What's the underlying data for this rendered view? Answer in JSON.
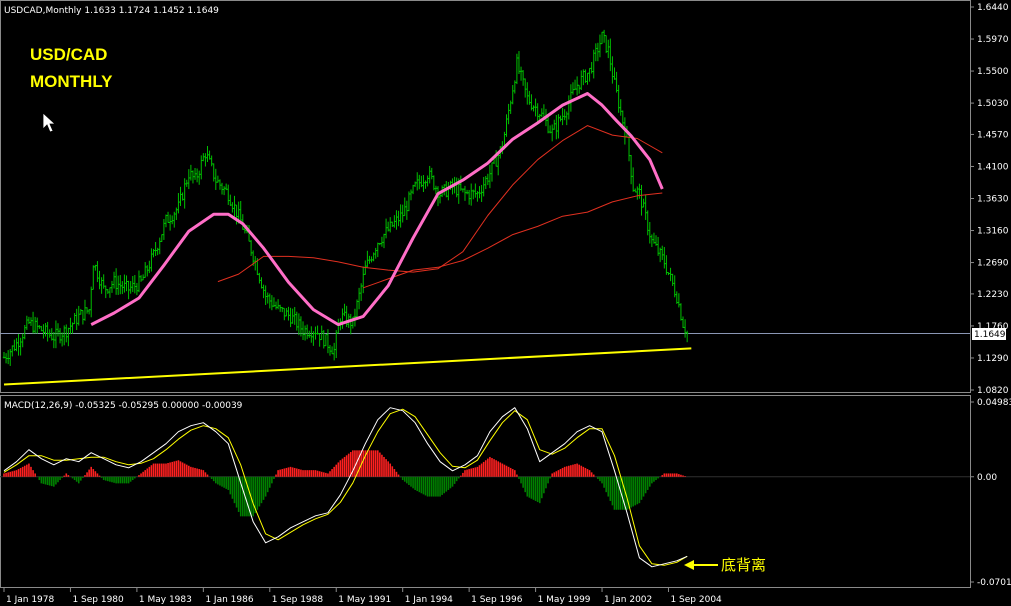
{
  "main_header": "USDCAD,Monthly  1.1633 1.1724 1.1452 1.1649",
  "title_line1": "USD/CAD",
  "title_line2": "MONTHLY",
  "macd_header": "MACD(12,26,9) -0.05325 -0.05295 0.00000 -0.00039",
  "annotation": "底背离",
  "current_price_label": "1.1649",
  "colors": {
    "background": "#000000",
    "bars": "#00c000",
    "ma_pink": "#ff6ec7",
    "ma_red": "#e03020",
    "trendline": "#ffff00",
    "hist_up": "#ff2020",
    "hist_down": "#008000",
    "macd_line": "#ffffff",
    "signal_line": "#ffff00"
  },
  "chart_data": [
    {
      "type": "ohlc",
      "title": "USDCAD,Monthly",
      "ohlc_last": {
        "open": 1.1633,
        "high": 1.1724,
        "low": 1.1452,
        "close": 1.1649
      },
      "x_tick_labels": [
        "1 Jan 1978",
        "1 Sep 1980",
        "1 May 1983",
        "1 Jan 1986",
        "1 Sep 1988",
        "1 May 1991",
        "1 Jan 1994",
        "1 Sep 1996",
        "1 May 1999",
        "1 Jan 2002",
        "1 Sep 2004"
      ],
      "y_tick_labels": [
        "1.6440",
        "1.5970",
        "1.5500",
        "1.5030",
        "1.4570",
        "1.4100",
        "1.3630",
        "1.3160",
        "1.2690",
        "1.2230",
        "1.1760",
        "1.1290",
        "1.0820"
      ],
      "ylim": [
        1.082,
        1.644
      ],
      "current_price": 1.1649,
      "close_path": [
        [
          "1978-01",
          1.13
        ],
        [
          "1978-07",
          1.15
        ],
        [
          "1979-01",
          1.18
        ],
        [
          "1979-07",
          1.17
        ],
        [
          "1980-01",
          1.16
        ],
        [
          "1980-07",
          1.17
        ],
        [
          "1981-01",
          1.19
        ],
        [
          "1981-06",
          1.2
        ],
        [
          "1981-08",
          1.27
        ],
        [
          "1982-01",
          1.23
        ],
        [
          "1982-06",
          1.24
        ],
        [
          "1983-01",
          1.23
        ],
        [
          "1983-07",
          1.24
        ],
        [
          "1984-01",
          1.28
        ],
        [
          "1984-07",
          1.33
        ],
        [
          "1985-01",
          1.35
        ],
        [
          "1985-06",
          1.4
        ],
        [
          "1985-09",
          1.39
        ],
        [
          "1986-02",
          1.43
        ],
        [
          "1986-07",
          1.39
        ],
        [
          "1987-01",
          1.37
        ],
        [
          "1987-07",
          1.33
        ],
        [
          "1988-01",
          1.28
        ],
        [
          "1988-07",
          1.22
        ],
        [
          "1989-01",
          1.2
        ],
        [
          "1989-07",
          1.19
        ],
        [
          "1990-01",
          1.17
        ],
        [
          "1990-07",
          1.17
        ],
        [
          "1991-01",
          1.15
        ],
        [
          "1991-04",
          1.14
        ],
        [
          "1991-07",
          1.19
        ],
        [
          "1992-01",
          1.18
        ],
        [
          "1992-04",
          1.22
        ],
        [
          "1992-07",
          1.26
        ],
        [
          "1993-01",
          1.3
        ],
        [
          "1993-07",
          1.32
        ],
        [
          "1994-01",
          1.34
        ],
        [
          "1994-07",
          1.38
        ],
        [
          "1995-01",
          1.4
        ],
        [
          "1995-07",
          1.37
        ],
        [
          "1996-01",
          1.38
        ],
        [
          "1996-07",
          1.37
        ],
        [
          "1997-01",
          1.37
        ],
        [
          "1997-07",
          1.4
        ],
        [
          "1998-01",
          1.44
        ],
        [
          "1998-08",
          1.56
        ],
        [
          "1999-01",
          1.51
        ],
        [
          "1999-07",
          1.49
        ],
        [
          "2000-01",
          1.46
        ],
        [
          "2000-07",
          1.49
        ],
        [
          "2001-01",
          1.53
        ],
        [
          "2001-07",
          1.55
        ],
        [
          "2002-01",
          1.6
        ],
        [
          "2002-04",
          1.58
        ],
        [
          "2002-07",
          1.53
        ],
        [
          "2003-01",
          1.45
        ],
        [
          "2003-04",
          1.38
        ],
        [
          "2003-07",
          1.37
        ],
        [
          "2004-01",
          1.3
        ],
        [
          "2004-07",
          1.27
        ],
        [
          "2005-01",
          1.22
        ],
        [
          "2005-04",
          1.18
        ],
        [
          "2005-06",
          1.165
        ]
      ],
      "ma_pink": [
        [
          "1981-07",
          1.178
        ],
        [
          "1982-06",
          1.195
        ],
        [
          "1983-06",
          1.217
        ],
        [
          "1984-06",
          1.265
        ],
        [
          "1985-06",
          1.315
        ],
        [
          "1986-06",
          1.34
        ],
        [
          "1987-01",
          1.34
        ],
        [
          "1987-08",
          1.326
        ],
        [
          "1988-06",
          1.29
        ],
        [
          "1989-06",
          1.24
        ],
        [
          "1990-06",
          1.2
        ],
        [
          "1991-06",
          1.178
        ],
        [
          "1992-06",
          1.19
        ],
        [
          "1993-06",
          1.235
        ],
        [
          "1994-06",
          1.305
        ],
        [
          "1995-06",
          1.37
        ],
        [
          "1996-06",
          1.39
        ],
        [
          "1997-06",
          1.415
        ],
        [
          "1998-06",
          1.45
        ],
        [
          "1999-06",
          1.474
        ],
        [
          "2000-06",
          1.5
        ],
        [
          "2001-06",
          1.517
        ],
        [
          "2002-01",
          1.5
        ],
        [
          "2002-08",
          1.477
        ],
        [
          "2003-03",
          1.455
        ],
        [
          "2003-12",
          1.42
        ],
        [
          "2004-06",
          1.377
        ]
      ],
      "ma_red_1": [
        [
          "1986-08",
          1.241
        ],
        [
          "1987-06",
          1.252
        ],
        [
          "1988-06",
          1.278
        ],
        [
          "1989-06",
          1.278
        ],
        [
          "1990-06",
          1.276
        ],
        [
          "1991-06",
          1.27
        ],
        [
          "1992-06",
          1.262
        ],
        [
          "1993-06",
          1.258
        ],
        [
          "1994-06",
          1.255
        ],
        [
          "1995-06",
          1.26
        ],
        [
          "1996-06",
          1.285
        ],
        [
          "1997-06",
          1.338
        ],
        [
          "1998-06",
          1.383
        ],
        [
          "1999-06",
          1.42
        ],
        [
          "2000-06",
          1.448
        ],
        [
          "2001-06",
          1.47
        ],
        [
          "2002-06",
          1.456
        ],
        [
          "2003-06",
          1.451
        ],
        [
          "2004-06",
          1.43
        ]
      ],
      "ma_red_2": [
        [
          "1992-06",
          1.232
        ],
        [
          "1993-06",
          1.245
        ],
        [
          "1994-06",
          1.258
        ],
        [
          "1995-06",
          1.262
        ],
        [
          "1996-06",
          1.272
        ],
        [
          "1997-06",
          1.29
        ],
        [
          "1998-06",
          1.31
        ],
        [
          "1999-06",
          1.322
        ],
        [
          "2000-06",
          1.337
        ],
        [
          "2001-06",
          1.343
        ],
        [
          "2002-06",
          1.358
        ],
        [
          "2003-06",
          1.367
        ],
        [
          "2004-06",
          1.371
        ]
      ],
      "trendline": [
        [
          "1978-01",
          1.09
        ],
        [
          "2005-08",
          1.143
        ]
      ]
    },
    {
      "type": "macd",
      "title": "MACD(12,26,9)",
      "params": [
        12,
        26,
        9
      ],
      "values": {
        "macd": -0.05325,
        "signal": -0.05295,
        "hist": 0.0,
        "hist2": -0.00039
      },
      "y_tick_labels": [
        "0.04983",
        "0.00",
        "-0.07016"
      ],
      "ylim": [
        -0.07016,
        0.04983
      ],
      "macd_line": [
        [
          "1978-01",
          0.004
        ],
        [
          "1978-07",
          0.01
        ],
        [
          "1979-01",
          0.018
        ],
        [
          "1979-07",
          0.012
        ],
        [
          "1980-01",
          0.008
        ],
        [
          "1980-07",
          0.012
        ],
        [
          "1981-01",
          0.01
        ],
        [
          "1981-07",
          0.016
        ],
        [
          "1982-01",
          0.012
        ],
        [
          "1982-07",
          0.008
        ],
        [
          "1983-01",
          0.006
        ],
        [
          "1983-07",
          0.01
        ],
        [
          "1984-01",
          0.016
        ],
        [
          "1984-07",
          0.022
        ],
        [
          "1985-01",
          0.03
        ],
        [
          "1985-07",
          0.034
        ],
        [
          "1986-01",
          0.036
        ],
        [
          "1986-07",
          0.03
        ],
        [
          "1987-01",
          0.022
        ],
        [
          "1987-07",
          -0.004
        ],
        [
          "1988-01",
          -0.03
        ],
        [
          "1988-07",
          -0.044
        ],
        [
          "1989-01",
          -0.04
        ],
        [
          "1989-07",
          -0.034
        ],
        [
          "1990-01",
          -0.03
        ],
        [
          "1990-07",
          -0.026
        ],
        [
          "1991-01",
          -0.024
        ],
        [
          "1991-07",
          -0.012
        ],
        [
          "1992-01",
          0.004
        ],
        [
          "1992-07",
          0.022
        ],
        [
          "1993-01",
          0.038
        ],
        [
          "1993-07",
          0.046
        ],
        [
          "1994-01",
          0.044
        ],
        [
          "1994-07",
          0.036
        ],
        [
          "1995-01",
          0.022
        ],
        [
          "1995-07",
          0.01
        ],
        [
          "1996-01",
          0.004
        ],
        [
          "1996-07",
          0.008
        ],
        [
          "1997-01",
          0.014
        ],
        [
          "1997-07",
          0.03
        ],
        [
          "1998-01",
          0.04
        ],
        [
          "1998-07",
          0.046
        ],
        [
          "1999-01",
          0.032
        ],
        [
          "1999-07",
          0.01
        ],
        [
          "2000-01",
          0.016
        ],
        [
          "2000-07",
          0.022
        ],
        [
          "2001-01",
          0.03
        ],
        [
          "2001-07",
          0.034
        ],
        [
          "2002-01",
          0.03
        ],
        [
          "2002-07",
          0.004
        ],
        [
          "2003-01",
          -0.024
        ],
        [
          "2003-07",
          -0.054
        ],
        [
          "2004-01",
          -0.06
        ],
        [
          "2004-07",
          -0.058
        ],
        [
          "2005-01",
          -0.056
        ],
        [
          "2005-06",
          -0.053
        ]
      ],
      "signal_line": [
        [
          "1978-01",
          0.003
        ],
        [
          "1978-07",
          0.008
        ],
        [
          "1979-01",
          0.014
        ],
        [
          "1979-07",
          0.014
        ],
        [
          "1980-01",
          0.011
        ],
        [
          "1980-07",
          0.011
        ],
        [
          "1981-01",
          0.012
        ],
        [
          "1981-07",
          0.013
        ],
        [
          "1982-01",
          0.013
        ],
        [
          "1982-07",
          0.01
        ],
        [
          "1983-01",
          0.008
        ],
        [
          "1983-07",
          0.009
        ],
        [
          "1984-01",
          0.012
        ],
        [
          "1984-07",
          0.018
        ],
        [
          "1985-01",
          0.025
        ],
        [
          "1985-07",
          0.031
        ],
        [
          "1986-01",
          0.034
        ],
        [
          "1986-07",
          0.032
        ],
        [
          "1987-01",
          0.026
        ],
        [
          "1987-07",
          0.008
        ],
        [
          "1988-01",
          -0.018
        ],
        [
          "1988-07",
          -0.038
        ],
        [
          "1989-01",
          -0.042
        ],
        [
          "1989-07",
          -0.037
        ],
        [
          "1990-01",
          -0.032
        ],
        [
          "1990-07",
          -0.028
        ],
        [
          "1991-01",
          -0.025
        ],
        [
          "1991-07",
          -0.017
        ],
        [
          "1992-01",
          -0.004
        ],
        [
          "1992-07",
          0.014
        ],
        [
          "1993-01",
          0.03
        ],
        [
          "1993-07",
          0.042
        ],
        [
          "1994-01",
          0.045
        ],
        [
          "1994-07",
          0.04
        ],
        [
          "1995-01",
          0.028
        ],
        [
          "1995-07",
          0.016
        ],
        [
          "1996-01",
          0.007
        ],
        [
          "1996-07",
          0.006
        ],
        [
          "1997-01",
          0.011
        ],
        [
          "1997-07",
          0.024
        ],
        [
          "1998-01",
          0.036
        ],
        [
          "1998-07",
          0.044
        ],
        [
          "1999-01",
          0.038
        ],
        [
          "1999-07",
          0.018
        ],
        [
          "2000-01",
          0.015
        ],
        [
          "2000-07",
          0.019
        ],
        [
          "2001-01",
          0.026
        ],
        [
          "2001-07",
          0.032
        ],
        [
          "2002-01",
          0.032
        ],
        [
          "2002-07",
          0.014
        ],
        [
          "2003-01",
          -0.014
        ],
        [
          "2003-07",
          -0.046
        ],
        [
          "2004-01",
          -0.058
        ],
        [
          "2004-07",
          -0.059
        ],
        [
          "2005-01",
          -0.057
        ],
        [
          "2005-06",
          -0.053
        ]
      ]
    }
  ]
}
